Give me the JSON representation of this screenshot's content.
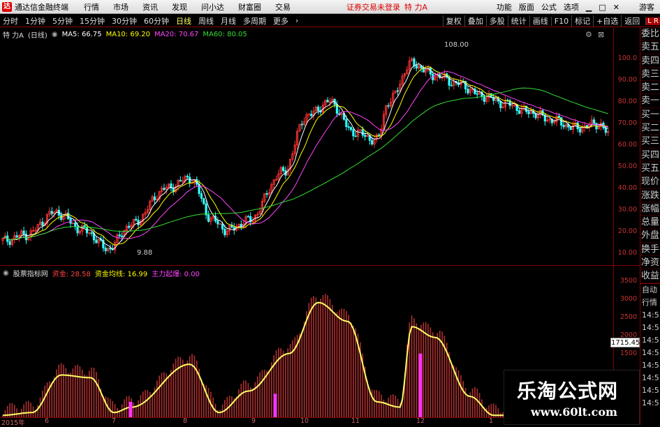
{
  "menu": {
    "app_name": "通达信金融终端",
    "items": [
      "行情",
      "市场",
      "资讯",
      "发现",
      "问小达",
      "财富圈",
      "交易"
    ],
    "alert": "证券交易未登录",
    "stock_title": "特 力A",
    "right_items": [
      "功能",
      "版面",
      "公式",
      "选项"
    ],
    "guest": "游客"
  },
  "toolbar": {
    "periods": [
      "分时",
      "1分钟",
      "5分钟",
      "15分钟",
      "30分钟",
      "60分钟",
      "日线",
      "周线",
      "月线",
      "多周期",
      "更多"
    ],
    "active": "日线",
    "right_items": [
      "复权",
      "叠加",
      "多股",
      "统计",
      "画线",
      "F10",
      "标记",
      "+自选",
      "返回"
    ],
    "lr": "L R"
  },
  "main_legend": {
    "name": "特 力A",
    "period": "(日线)",
    "ma5": "MA5: 66.75",
    "ma10": "MA10: 69.20",
    "ma20": "MA20: 70.67",
    "ma60": "MA60: 80.05"
  },
  "annotations": {
    "high": "108.00",
    "low": "9.88"
  },
  "main_axis": [
    "100.0",
    "90.00",
    "80.00",
    "70.00",
    "60.00",
    "50.00",
    "40.00",
    "30.00",
    "20.00",
    "10.00"
  ],
  "sub_legend": {
    "name": "股票指标网",
    "l1": "资金: 28.58",
    "l2": "资金均线: 16.99",
    "l3": "主力起爆: 0.00"
  },
  "sub_axis": [
    "3500",
    "3000",
    "2500",
    "2000",
    "1500"
  ],
  "price_tag": "1715.45",
  "date_axis": [
    "2015年",
    "6",
    "7",
    "8",
    "9",
    "10",
    "11",
    "12",
    "1"
  ],
  "side_items": [
    "委比",
    "卖五",
    "卖四",
    "卖三",
    "卖二",
    "卖一",
    "买一",
    "买二",
    "买三",
    "买四",
    "买五",
    "现价",
    "涨跌",
    "涨幅",
    "总量",
    "外盘",
    "换手",
    "净资",
    "收益"
  ],
  "side_bottom": [
    "自动",
    "行情",
    "14:5",
    "14:5",
    "14:5",
    "14:5",
    "14:5",
    "14:5",
    "14:5",
    "14:5"
  ],
  "watermark": {
    "title": "乐淘公式网",
    "url": "www.60lt.com"
  },
  "colors": {
    "up": "#ff3333",
    "down": "#33ffff",
    "ma5": "#ffffff",
    "ma10": "#ffff00",
    "ma20": "#ff44ff",
    "ma60": "#33dd33"
  },
  "chart_data": {
    "type": "candlestick",
    "series": [
      {
        "name": "MA5",
        "values": [
          66.75
        ]
      },
      {
        "name": "MA10",
        "values": [
          69.2
        ]
      },
      {
        "name": "MA20",
        "values": [
          70.67
        ]
      },
      {
        "name": "MA60",
        "values": [
          80.05
        ]
      }
    ],
    "price_range": [
      8,
      112
    ],
    "high": 108.0,
    "low": 9.88,
    "sub_indicator": {
      "name": "股票指标网",
      "values": {
        "资金": 28.58,
        "资金均线": 16.99,
        "主力起爆": 0.0
      },
      "range": [
        1000,
        3600
      ]
    }
  }
}
